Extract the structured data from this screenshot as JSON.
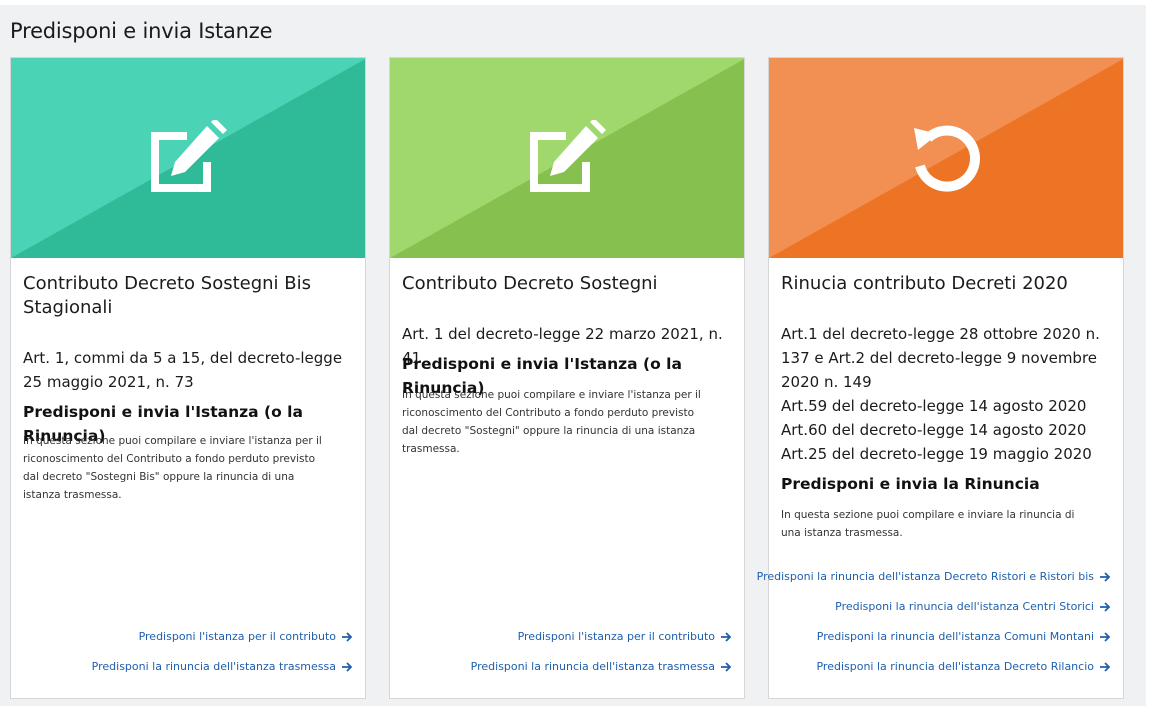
{
  "section": {
    "title": "Predisponi e invia Istanze"
  },
  "colors": {
    "teal_light": "#4ad3b4",
    "teal_dark": "#2fbb97",
    "green_light": "#a0d86e",
    "green_dark": "#86c04e",
    "orange_light": "#f28f52",
    "orange_dark": "#ee7425",
    "link": "#1e5fae"
  },
  "cards": [
    {
      "icon": "edit-icon",
      "title": "Contributo Decreto Sostegni Bis Stagionali",
      "lines": [
        "Art. 1, commi da 5 a 15, del decreto-legge 25 maggio 2021, n. 73"
      ],
      "subhead": "Predisponi e invia l'Istanza (o la Rinuncia)",
      "description": "In questa sezione puoi compilare e inviare l'istanza per il riconoscimento del Contributo a fondo perduto previsto dal decreto \"Sostegni Bis\" oppure la rinuncia di una istanza trasmessa.",
      "links": [
        "Predisponi l'istanza per il contributo",
        "Predisponi la rinuncia dell'istanza trasmessa"
      ]
    },
    {
      "icon": "edit-icon",
      "title": "Contributo Decreto Sostegni",
      "lines": [
        "Art. 1 del decreto-legge 22 marzo 2021, n. 41"
      ],
      "subhead": "Predisponi e invia l'Istanza (o la Rinuncia)",
      "description": "In questa sezione puoi compilare e inviare l'istanza per il riconoscimento del Contributo a fondo perduto previsto dal decreto \"Sostegni\" oppure la rinuncia di una istanza trasmessa.",
      "links": [
        "Predisponi l'istanza per il contributo",
        "Predisponi la rinuncia dell'istanza trasmessa"
      ]
    },
    {
      "icon": "undo-icon",
      "title": "Rinucia contributo Decreti 2020",
      "lines": [
        "Art.1 del decreto-legge 28 ottobre 2020 n. 137 e Art.2 del decreto-legge 9 novembre 2020 n. 149",
        "Art.59 del decreto-legge 14 agosto 2020",
        "Art.60 del decreto-legge 14 agosto 2020",
        "Art.25 del decreto-legge 19 maggio 2020"
      ],
      "subhead": "Predisponi e invia la Rinuncia",
      "description": "In questa sezione puoi compilare e inviare la rinuncia di una istanza trasmessa.",
      "links": [
        "Predisponi la rinuncia dell'istanza Decreto Ristori e Ristori bis",
        "Predisponi la rinuncia dell'istanza Centri Storici",
        "Predisponi la rinuncia dell'istanza Comuni Montani",
        "Predisponi la rinuncia dell'istanza Decreto Rilancio"
      ]
    }
  ]
}
